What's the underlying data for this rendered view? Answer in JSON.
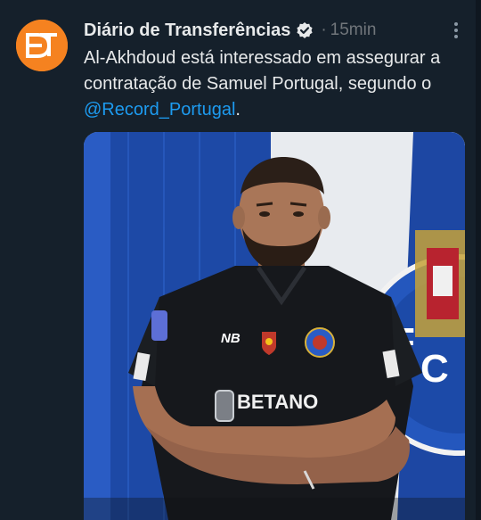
{
  "account": {
    "name": "Diário de Transferências",
    "avatar_text": "DT",
    "verified": true
  },
  "meta": {
    "separator": "·",
    "time": "15min"
  },
  "tweet": {
    "text_before": "Al-Akhdoud está interessado em assegurar a contratação de Samuel Portugal, segundo o ",
    "mention": "@Record_Portugal",
    "text_after": "."
  },
  "image": {
    "sponsor": "BETANO",
    "kit_brand": "NB",
    "crest_letters": "FC"
  },
  "colors": {
    "background": "#15202b",
    "accent": "#1d9bf0",
    "avatar": "#f58220",
    "muted": "#71767b"
  },
  "icons": {
    "verified": "verified-badge-icon",
    "more": "more-dots-icon"
  }
}
